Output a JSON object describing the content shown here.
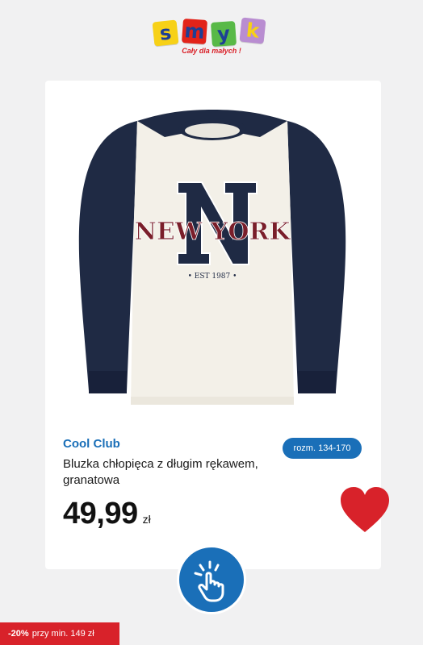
{
  "logo": {
    "letters": [
      "s",
      "m",
      "y",
      "k"
    ],
    "tagline": "Cały dla małych !"
  },
  "product": {
    "brand": "Cool Club",
    "size": "rozm. 134-170",
    "title": "Bluzka chłopięca z długim rękawem, granatowa",
    "price": "49,99",
    "currency": "zł",
    "print_text": "NEW YORK",
    "print_sub": "• EST 1987 •"
  },
  "promo": {
    "discount": "-20%",
    "text": "przy min. 149 zł"
  },
  "colors": {
    "accent_blue": "#1a6fb8",
    "navy": "#1f2a44",
    "heart_red": "#d8222a",
    "promo_red": "#d8222a"
  },
  "icons": {
    "favorite": "heart-icon",
    "tap": "tap-hand-icon"
  }
}
